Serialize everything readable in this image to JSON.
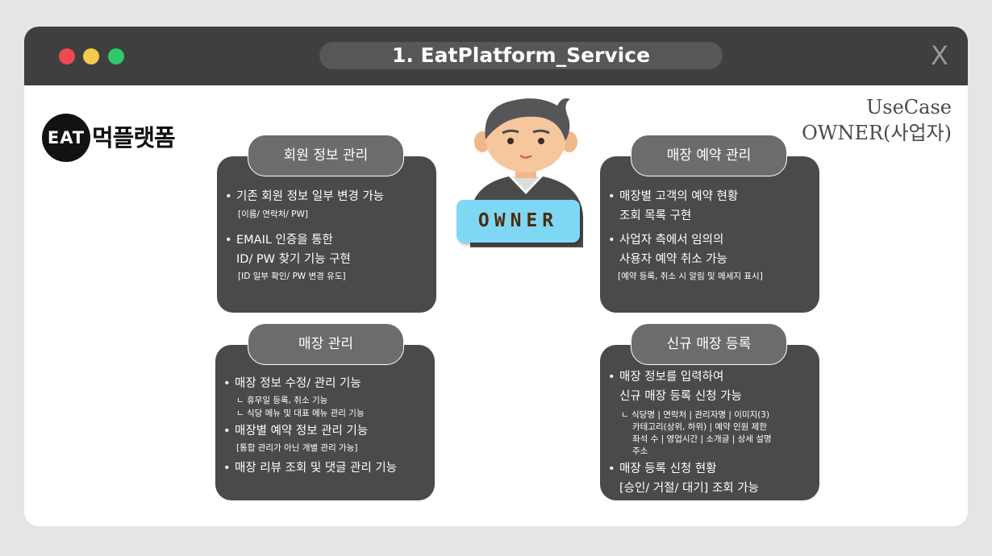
{
  "window": {
    "title": "1. EatPlatform_Service",
    "close_label": "X",
    "dots": [
      "red",
      "yellow",
      "green"
    ],
    "colors": {
      "red": "#f0484f",
      "yellow": "#f2cd4c",
      "green": "#2ec86d",
      "titlebar": "#3f3f3f",
      "box": "#4a4a4d",
      "badge": "#7fd8f3"
    }
  },
  "logo": {
    "emblem": "EAT",
    "text": "먹플랫폼"
  },
  "usecase": {
    "line1": "UseCase",
    "line2": "OWNER(사업자)"
  },
  "owner_badge": "OWNER",
  "sections": {
    "member": {
      "title": "회원 정보 관리",
      "b1": "기존 회원 정보 일부 변경 가능",
      "b1_sub": "[이름/ 연락처/ PW]",
      "b2_l1": "EMAIL 인증을 통한",
      "b2_l2": "ID/ PW 찾기 기능 구현",
      "b2_sub": "[ID 일부  확인/ PW 변경 유도]"
    },
    "store": {
      "title": "매장 관리",
      "b1": "매장 정보 수정/ 관리 기능",
      "b1_sub1": "ㄴ 휴무일 등록, 취소 기능",
      "b1_sub2": "ㄴ 식당 메뉴 및 대표 메뉴 관리 기능",
      "b2": "매장별 예약 정보 관리 기능",
      "b2_sub": "[통합 관리가 아닌 개별 관리 가능]",
      "b3": "매장 리뷰 조회 및 댓글 관리 기능"
    },
    "reservation": {
      "title": "매장 예약 관리",
      "b1_l1": "매장별 고객의 예약 현황",
      "b1_l2": "조회 목록  구현",
      "b2_l1": "사업자 측에서 임의의",
      "b2_l2": "사용자 예약 취소 가능",
      "b2_sub": "[예약 등록, 취소 시 알림 및 메세지 표시]"
    },
    "register": {
      "title": "신규 매장 등록",
      "b1_l1": "매장 정보를 입력하여",
      "b1_l2": "신규 매장 등록 신청 가능",
      "sub1": "ㄴ 식당명 | 연락처 | 관리자명 | 이미지(3)",
      "sub2": "카테고리(상위, 하위) | 예약 인원 제한",
      "sub3": "좌석 수 | 영업시간 | 소개글 | 상세 설명",
      "sub4": "주소",
      "b2_l1": "매장 등록 신청 현황",
      "b2_l2": "[승인/ 거절/ 대기] 조회 가능"
    }
  }
}
